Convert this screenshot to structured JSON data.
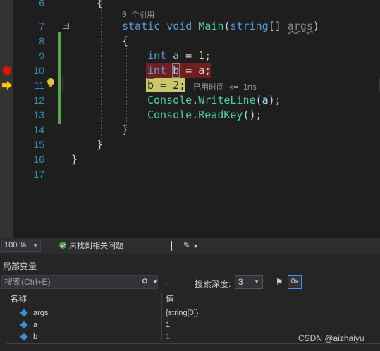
{
  "editor": {
    "line_numbers": [
      "6",
      "7",
      "8",
      "9",
      "10",
      "11",
      "12",
      "13",
      "14",
      "15",
      "16",
      "17"
    ],
    "codelens_refs": "0 个引用",
    "perf_tip": "已用时间 <= 1ms",
    "code": {
      "l6": "{",
      "l7_kw1": "static",
      "l7_kw2": "void",
      "l7_fn": "Main",
      "l7_paren": "(",
      "l7_kw3": "string",
      "l7_rest": "[] ",
      "l7_arg": "args",
      "l7_close": ")",
      "l8": "{",
      "l9_kw": "int",
      "l9_var": "a",
      "l9_eq": " = ",
      "l9_num": "1",
      "l9_end": ";",
      "l10_kw": "int",
      "l10_var": "b",
      "l10_rest": " = a;",
      "l11_var": "b",
      "l11_rest": " = 2;",
      "l12_cls": "Console",
      "l12_dot": ".",
      "l12_fn": "WriteLine",
      "l12_open": "(",
      "l12_arg": "a",
      "l12_close": ");",
      "l13_cls": "Console",
      "l13_dot": ".",
      "l13_fn": "ReadKey",
      "l13_rest": "();",
      "l14": "}",
      "l15": "}",
      "l16": "}"
    }
  },
  "statusbar": {
    "zoom": "100 %",
    "issues": "未找到相关问题"
  },
  "locals": {
    "title": "局部变量",
    "search_placeholder": "搜索(Ctrl+E)",
    "depth_label": "搜索深度:",
    "depth_value": "3",
    "columns": {
      "name": "名称",
      "value": "值"
    },
    "rows": [
      {
        "name": "args",
        "value": "{string[0]}"
      },
      {
        "name": "a",
        "value": "1"
      },
      {
        "name": "b",
        "value": "1"
      }
    ]
  },
  "watermark": "CSDN @aizhaiyu",
  "colors": {
    "breakpoint": "#e51400",
    "current_line": "#c8c86a",
    "keyword": "#569cd6"
  }
}
